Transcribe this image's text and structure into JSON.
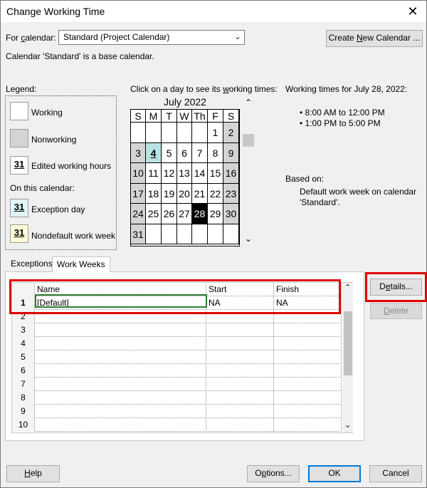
{
  "window": {
    "title": "Change Working Time"
  },
  "calendar_select": {
    "label_prefix": "For ",
    "label_u": "c",
    "label_suffix": "alendar:",
    "value": "Standard (Project Calendar)"
  },
  "create_button": {
    "pre": "Create ",
    "u": "N",
    "post": "ew Calendar ..."
  },
  "base_note": "Calendar 'Standard' is a base calendar.",
  "legend": {
    "title": "Legend:",
    "working": "Working",
    "nonworking": "Nonworking",
    "edited": "Edited working hours",
    "edited_num": "31",
    "on_this_calendar": "On this calendar:",
    "exception": "Exception day",
    "exception_num": "31",
    "nondefault": "Nondefault work week",
    "nondefault_num": "31"
  },
  "calendar_prompt": {
    "pre": "Click on a day to see its ",
    "u": "w",
    "post": "orking times:"
  },
  "month": {
    "title": "July 2022",
    "weekdays": [
      "S",
      "M",
      "T",
      "W",
      "Th",
      "F",
      "S"
    ],
    "weeks": [
      [
        "",
        "",
        "",
        "",
        "",
        "1",
        "2"
      ],
      [
        "3",
        "4",
        "5",
        "6",
        "7",
        "8",
        "9"
      ],
      [
        "10",
        "11",
        "12",
        "13",
        "14",
        "15",
        "16"
      ],
      [
        "17",
        "18",
        "19",
        "20",
        "21",
        "22",
        "23"
      ],
      [
        "24",
        "25",
        "26",
        "27",
        "28",
        "29",
        "30"
      ],
      [
        "31",
        "",
        "",
        "",
        "",
        "",
        ""
      ]
    ]
  },
  "working_times": {
    "title": "Working times for July 28, 2022:",
    "items": [
      "• 8:00 AM to 12:00 PM",
      "• 1:00 PM to 5:00 PM"
    ],
    "based_on_label": "Based on:",
    "based_on_text": "Default work week on calendar 'Standard'."
  },
  "tabs": [
    "Exceptions",
    "Work Weeks"
  ],
  "grid": {
    "columns": [
      "Name",
      "Start",
      "Finish"
    ],
    "rows": [
      {
        "num": "1",
        "name": "[Default]",
        "start": "NA",
        "finish": "NA"
      },
      {
        "num": "2",
        "name": "",
        "start": "",
        "finish": ""
      },
      {
        "num": "3",
        "name": "",
        "start": "",
        "finish": ""
      },
      {
        "num": "4",
        "name": "",
        "start": "",
        "finish": ""
      },
      {
        "num": "5",
        "name": "",
        "start": "",
        "finish": ""
      },
      {
        "num": "6",
        "name": "",
        "start": "",
        "finish": ""
      },
      {
        "num": "7",
        "name": "",
        "start": "",
        "finish": ""
      },
      {
        "num": "8",
        "name": "",
        "start": "",
        "finish": ""
      },
      {
        "num": "9",
        "name": "",
        "start": "",
        "finish": ""
      },
      {
        "num": "10",
        "name": "",
        "start": "",
        "finish": ""
      }
    ]
  },
  "details_button": {
    "pre": "D",
    "u": "e",
    "post": "tails..."
  },
  "delete_button": {
    "pre": "",
    "u": "D",
    "post": "elete"
  },
  "footer": {
    "help": {
      "pre": "",
      "u": "H",
      "post": "elp"
    },
    "options": {
      "pre": "O",
      "u": "p",
      "post": "tions..."
    },
    "ok": "OK",
    "cancel": "Cancel"
  }
}
